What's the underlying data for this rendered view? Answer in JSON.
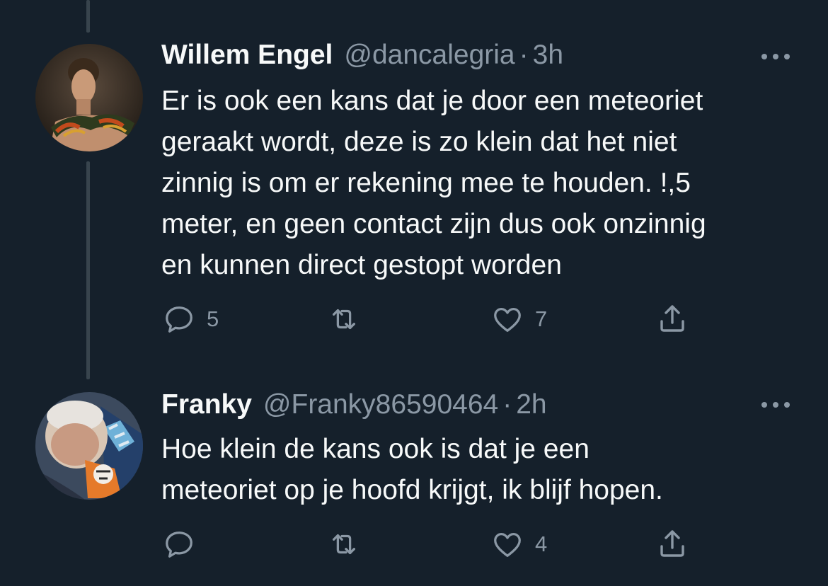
{
  "thread": [
    {
      "author": {
        "display_name": "Willem Engel",
        "handle": "@dancalegria",
        "avatar": "avatar-willem-engel"
      },
      "separator": "·",
      "time": "3h",
      "text": "Er is ook een kans dat je door een meteoriet\ngeraakt wordt, deze is zo klein dat het niet\nzinnig is om er rekening mee te houden. !,5\nmeter, en geen contact zijn dus ook onzinnig\nen kunnen direct gestopt worden",
      "actions": {
        "reply": {
          "icon": "reply-icon",
          "count": "5"
        },
        "retweet": {
          "icon": "retweet-icon",
          "count": ""
        },
        "like": {
          "icon": "heart-icon",
          "count": "7"
        },
        "share": {
          "icon": "share-icon"
        }
      },
      "more_icon": "more-options-icon"
    },
    {
      "author": {
        "display_name": "Franky",
        "handle": "@Franky86590464",
        "avatar": "avatar-franky"
      },
      "separator": "·",
      "time": "2h",
      "text": "Hoe klein de kans ook is dat je een\nmeteoriet op je hoofd krijgt, ik blijf hopen.",
      "actions": {
        "reply": {
          "icon": "reply-icon",
          "count": ""
        },
        "retweet": {
          "icon": "retweet-icon",
          "count": ""
        },
        "like": {
          "icon": "heart-icon",
          "count": "4"
        },
        "share": {
          "icon": "share-icon"
        }
      },
      "more_icon": "more-options-icon"
    }
  ],
  "colors": {
    "background": "#15202b",
    "primary_text": "#f7f9f9",
    "secondary_text": "#8b98a5",
    "thread_line": "#38444d"
  }
}
